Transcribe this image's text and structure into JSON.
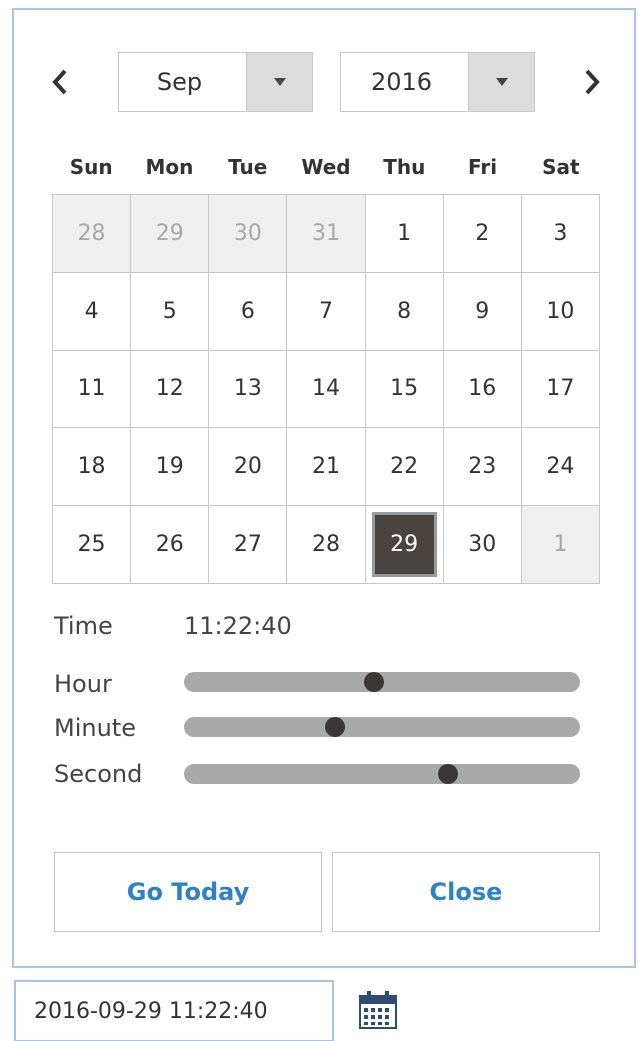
{
  "header": {
    "prev_icon": "chevron-left-icon",
    "next_icon": "chevron-right-icon",
    "month": "Sep",
    "year": "2016",
    "dropdown_icon": "caret-down-icon"
  },
  "weekdays": [
    "Sun",
    "Mon",
    "Tue",
    "Wed",
    "Thu",
    "Fri",
    "Sat"
  ],
  "days": [
    {
      "label": "28",
      "state": "other"
    },
    {
      "label": "29",
      "state": "other"
    },
    {
      "label": "30",
      "state": "other"
    },
    {
      "label": "31",
      "state": "other"
    },
    {
      "label": "1",
      "state": "current"
    },
    {
      "label": "2",
      "state": "current"
    },
    {
      "label": "3",
      "state": "current"
    },
    {
      "label": "4",
      "state": "current"
    },
    {
      "label": "5",
      "state": "current"
    },
    {
      "label": "6",
      "state": "current"
    },
    {
      "label": "7",
      "state": "current"
    },
    {
      "label": "8",
      "state": "current"
    },
    {
      "label": "9",
      "state": "current"
    },
    {
      "label": "10",
      "state": "current"
    },
    {
      "label": "11",
      "state": "current"
    },
    {
      "label": "12",
      "state": "current"
    },
    {
      "label": "13",
      "state": "current"
    },
    {
      "label": "14",
      "state": "current"
    },
    {
      "label": "15",
      "state": "current"
    },
    {
      "label": "16",
      "state": "current"
    },
    {
      "label": "17",
      "state": "current"
    },
    {
      "label": "18",
      "state": "current"
    },
    {
      "label": "19",
      "state": "current"
    },
    {
      "label": "20",
      "state": "current"
    },
    {
      "label": "21",
      "state": "current"
    },
    {
      "label": "22",
      "state": "current"
    },
    {
      "label": "23",
      "state": "current"
    },
    {
      "label": "24",
      "state": "current"
    },
    {
      "label": "25",
      "state": "current"
    },
    {
      "label": "26",
      "state": "current"
    },
    {
      "label": "27",
      "state": "current"
    },
    {
      "label": "28",
      "state": "current"
    },
    {
      "label": "29",
      "state": "selected"
    },
    {
      "label": "30",
      "state": "current"
    },
    {
      "label": "1",
      "state": "other"
    }
  ],
  "time": {
    "label": "Time",
    "value": "11:22:40",
    "hour_label": "Hour",
    "minute_label": "Minute",
    "second_label": "Second",
    "hour": 11,
    "hour_max": 23,
    "minute": 22,
    "minute_max": 59,
    "second": 40,
    "second_max": 59
  },
  "buttons": {
    "today_label": "Go Today",
    "close_label": "Close"
  },
  "input": {
    "value": "2016-09-29 11:22:40",
    "calendar_icon": "calendar-icon"
  },
  "colors": {
    "accent_blue": "#2e82c4",
    "panel_border": "#a9c4e3",
    "selected_day_bg": "#4a4440",
    "other_month_bg": "#efefef"
  }
}
